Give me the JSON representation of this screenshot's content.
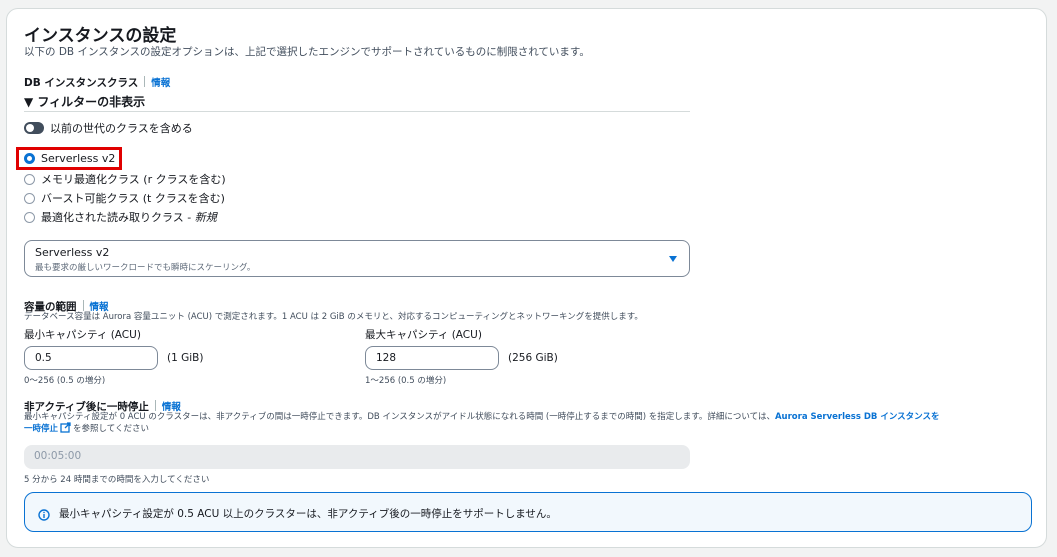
{
  "section": {
    "title": "インスタンスの設定",
    "description": "以下の DB インスタンスの設定オプションは、上記で選択したエンジンでサポートされているものに制限されています。"
  },
  "db_class": {
    "label": "DB インスタンスクラス",
    "info": "情報",
    "filter_toggle": "▼ フィルターの非表示",
    "include_previous_label": "以前の世代のクラスを含める",
    "include_previous_on": false,
    "options": [
      {
        "label": "Serverless v2",
        "selected": true
      },
      {
        "label": "メモリ最適化クラス (r クラスを含む)",
        "selected": false
      },
      {
        "label": "バースト可能クラス (t クラスを含む)",
        "selected": false
      },
      {
        "label": "最適化された読み取りクラス - ",
        "label_suffix": "新規",
        "selected": false
      }
    ],
    "select": {
      "title": "Serverless v2",
      "subtitle": "最も要求の厳しいワークロードでも瞬時にスケーリング。"
    }
  },
  "capacity": {
    "label": "容量の範囲",
    "info": "情報",
    "description": "データベース容量は Aurora 容量ユニット (ACU) で測定されます。1 ACU は 2 GiB のメモリと、対応するコンピューティングとネットワーキングを提供します。",
    "min": {
      "label": "最小キャパシティ (ACU)",
      "value": "0.5",
      "unit": "(1 GiB)",
      "hint": "0～256 (0.5 の増分)"
    },
    "max": {
      "label": "最大キャパシティ (ACU)",
      "value": "128",
      "unit": "(256 GiB)",
      "hint": "1～256 (0.5 の増分)"
    }
  },
  "pause": {
    "label": "非アクティブ後に一時停止",
    "info": "情報",
    "description": "最小キャパシティ設定が 0 ACU のクラスターは、非アクティブの間は一時停止できます。DB インスタンスがアイドル状態になれる時間 (一時停止するまでの時間) を指定します。詳細については、",
    "link_text_1": "Aurora Serverless DB インスタンスを",
    "link_text_2": "一時停止",
    "description_tail": "を参照してください",
    "value": "00:05:00",
    "hint": "5 分から 24 時間までの時間を入力してください"
  },
  "alert": {
    "text": "最小キャパシティ設定が 0.5 ACU 以上のクラスターは、非アクティブ後の一時停止をサポートしません。"
  }
}
